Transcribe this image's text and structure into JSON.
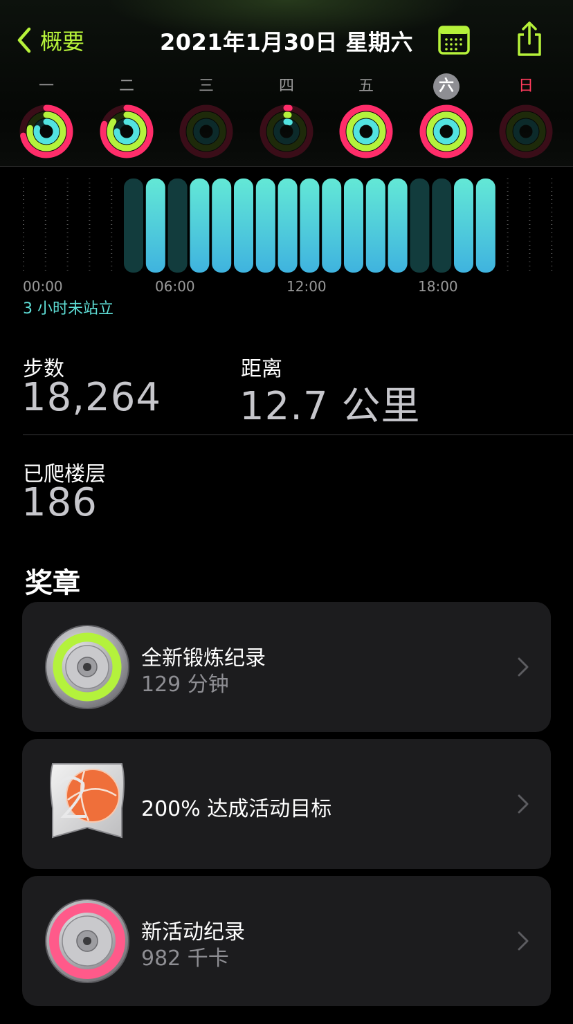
{
  "nav": {
    "back_label": "概要",
    "title": "2021年1月30日 星期六"
  },
  "week": {
    "days": [
      {
        "label": "一",
        "move": 0.72,
        "exercise": 0.78,
        "stand": 0.8
      },
      {
        "label": "二",
        "move": 0.8,
        "exercise": 0.85,
        "stand": 0.75
      },
      {
        "label": "三",
        "move": 0.0,
        "exercise": 0.0,
        "stand": 0.0
      },
      {
        "label": "四",
        "move": 0.02,
        "exercise": 0.02,
        "stand": 0.05
      },
      {
        "label": "五",
        "move": 1.0,
        "exercise": 1.0,
        "stand": 1.0
      },
      {
        "label": "六",
        "move": 1.0,
        "exercise": 1.0,
        "stand": 1.0
      },
      {
        "label": "日",
        "move": 0.0,
        "exercise": 0.0,
        "stand": 0.0
      }
    ],
    "selected_index": 5,
    "colors": {
      "move": "#ff2d6a",
      "exercise": "#b4f23c",
      "stand": "#52e3e0"
    }
  },
  "stand_chart": {
    "hours": [
      0,
      0,
      0,
      0,
      0,
      0,
      1,
      0,
      1,
      1,
      1,
      1,
      1,
      1,
      1,
      1,
      1,
      1,
      0,
      0,
      1,
      1,
      1,
      0,
      0,
      0
    ],
    "axis_labels": [
      "00:00",
      "06:00",
      "12:00",
      "18:00"
    ],
    "note": "3 小时未站立"
  },
  "stats": {
    "steps_label": "步数",
    "steps_value": "18,264",
    "distance_label": "距离",
    "distance_value": "12.7 公里",
    "floors_label": "已爬楼层",
    "floors_value": "186"
  },
  "awards": {
    "title": "奖章",
    "items": [
      {
        "title": "全新锻炼纪录",
        "subtitle": "129 分钟"
      },
      {
        "title": "200% 达成活动目标",
        "subtitle": ""
      },
      {
        "title": "新活动纪录",
        "subtitle": "982 千卡"
      }
    ]
  }
}
